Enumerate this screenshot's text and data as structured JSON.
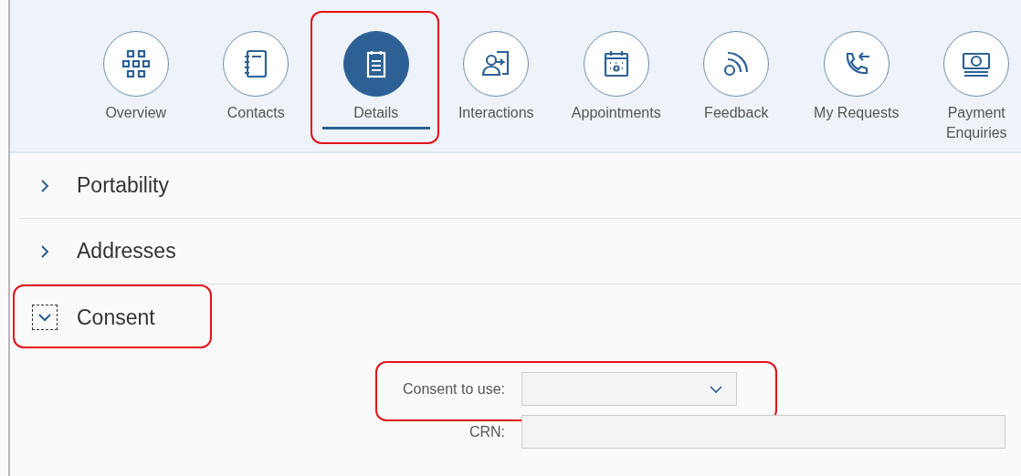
{
  "tabs": [
    {
      "label": "Overview",
      "selected": false,
      "highlighted": false
    },
    {
      "label": "Contacts",
      "selected": false,
      "highlighted": false
    },
    {
      "label": "Details",
      "selected": true,
      "highlighted": true
    },
    {
      "label": "Interactions",
      "selected": false,
      "highlighted": false
    },
    {
      "label": "Appointments",
      "selected": false,
      "highlighted": false
    },
    {
      "label": "Feedback",
      "selected": false,
      "highlighted": false
    },
    {
      "label": "My Requests",
      "selected": false,
      "highlighted": false
    },
    {
      "label": "Payment Enquiries",
      "selected": false,
      "highlighted": false
    }
  ],
  "sections": [
    {
      "title": "Portability",
      "expanded": false,
      "focused": false,
      "highlighted": false
    },
    {
      "title": "Addresses",
      "expanded": false,
      "focused": false,
      "highlighted": false
    },
    {
      "title": "Consent",
      "expanded": true,
      "focused": true,
      "highlighted": true
    }
  ],
  "consent_form": {
    "fields": [
      {
        "kind": "select",
        "label": "Consent to use:",
        "highlighted": true
      },
      {
        "kind": "text",
        "label": "CRN:",
        "highlighted": false
      }
    ]
  }
}
